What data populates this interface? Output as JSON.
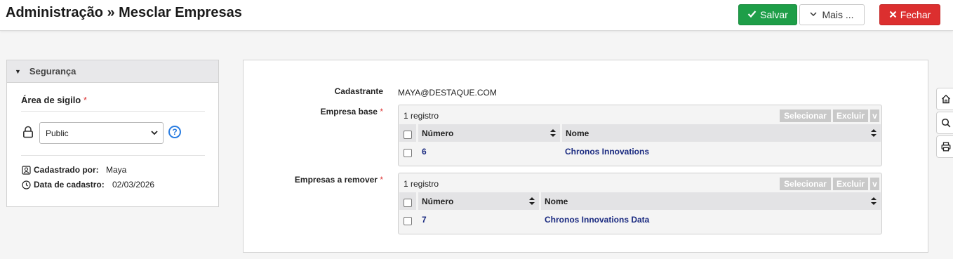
{
  "header": {
    "title": "Administração » Mesclar Empresas",
    "save_label": "Salvar",
    "more_label": "Mais ...",
    "close_label": "Fechar"
  },
  "colors": {
    "save": "#1e9e48",
    "close": "#dc2f2f",
    "link": "#1a2a80",
    "help": "#2a7de1"
  },
  "security": {
    "section_title": "Segurança",
    "area_label": "Área de sigilo",
    "required_mark": "*",
    "selected_option": "Public",
    "help_glyph": "?",
    "registered_by_label": "Cadastrado por:",
    "registered_by_value": "Maya",
    "registered_date_label": "Data de cadastro:",
    "registered_date_value": "02/03/2026"
  },
  "form": {
    "registrant_label": "Cadastrante",
    "registrant_value": "MAYA@DESTAQUE.COM",
    "base_label": "Empresa base",
    "remove_label": "Empresas a remover",
    "required_mark": "*"
  },
  "base_grid": {
    "count": "1 registro",
    "select_label": "Selecionar",
    "delete_label": "Excluir",
    "more_label": "v",
    "columns": [
      "Número",
      "Nome"
    ],
    "rows": [
      {
        "numero": "6",
        "nome": "Chronos Innovations"
      }
    ]
  },
  "remove_grid": {
    "count": "1 registro",
    "select_label": "Selecionar",
    "delete_label": "Excluir",
    "more_label": "v",
    "columns": [
      "Número",
      "Nome"
    ],
    "rows": [
      {
        "numero": "7",
        "nome": "Chronos Innovations Data"
      }
    ]
  },
  "side_tools": [
    "home-icon",
    "search-icon",
    "print-icon"
  ]
}
